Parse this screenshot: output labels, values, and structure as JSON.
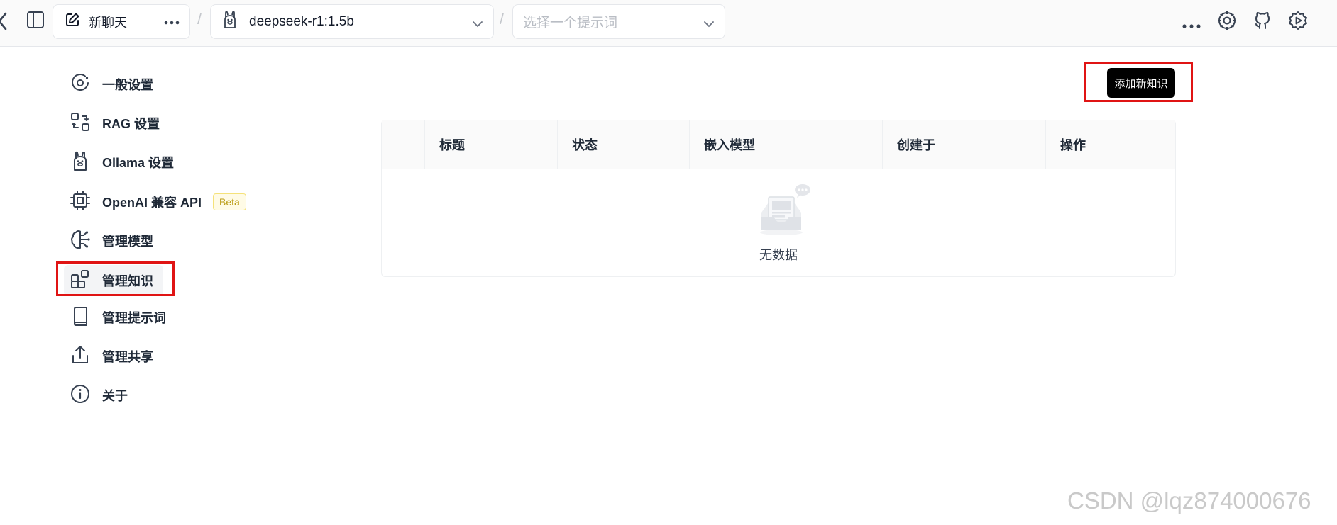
{
  "topbar": {
    "new_chat_label": "新聊天",
    "model_value": "deepseek-r1:1.5b",
    "prompt_placeholder": "选择一个提示词",
    "separator": "/"
  },
  "sidebar": {
    "items": [
      {
        "label": "一般设置",
        "icon": "general-settings-icon"
      },
      {
        "label": "RAG 设置",
        "icon": "rag-settings-icon"
      },
      {
        "label": "Ollama 设置",
        "icon": "llama-icon"
      },
      {
        "label": "OpenAI 兼容 API",
        "icon": "chip-icon",
        "badge": "Beta"
      },
      {
        "label": "管理模型",
        "icon": "brain-icon"
      },
      {
        "label": "管理知识",
        "icon": "blocks-icon",
        "active": true
      },
      {
        "label": "管理提示词",
        "icon": "book-icon"
      },
      {
        "label": "管理共享",
        "icon": "share-icon"
      },
      {
        "label": "关于",
        "icon": "info-icon"
      }
    ]
  },
  "main": {
    "add_button_label": "添加新知识",
    "table": {
      "columns": [
        "标题",
        "状态",
        "嵌入模型",
        "创建于",
        "操作"
      ],
      "rows": [],
      "empty_text": "无数据"
    }
  },
  "watermark": "CSDN @lqz874000676",
  "colors": {
    "highlight_box": "#e01414",
    "primary_button": "#000000",
    "beta_badge": "#b99a10"
  }
}
